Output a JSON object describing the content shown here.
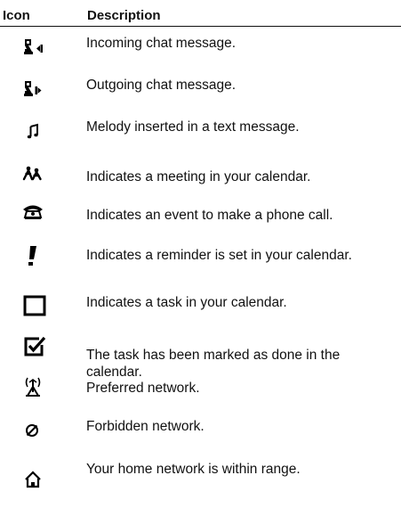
{
  "table": {
    "headers": {
      "icon": "Icon",
      "description": "Description"
    },
    "rows": [
      {
        "icon": "incoming-chat-icon",
        "description": "Incoming chat message."
      },
      {
        "icon": "outgoing-chat-icon",
        "description": "Outgoing chat message."
      },
      {
        "icon": "melody-icon",
        "description": "Melody inserted in a text message."
      },
      {
        "icon": "meeting-icon",
        "description": "Indicates a meeting in your calendar."
      },
      {
        "icon": "phone-call-icon",
        "description": "Indicates an event to make a phone call."
      },
      {
        "icon": "reminder-icon",
        "description": "Indicates a reminder is set in your calendar."
      },
      {
        "icon": "task-icon",
        "description": "Indicates a task in your calendar."
      },
      {
        "icon": "task-done-icon",
        "description": "The task has been marked as done in the calendar."
      },
      {
        "icon": "preferred-network-icon",
        "description": "Preferred network."
      },
      {
        "icon": "forbidden-network-icon",
        "description": "Forbidden network."
      },
      {
        "icon": "home-network-icon",
        "description": "Your home network is within range."
      }
    ]
  }
}
